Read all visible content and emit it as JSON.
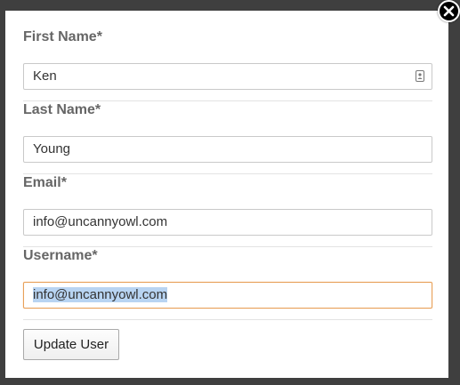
{
  "form": {
    "first_name": {
      "label": "First Name*",
      "value": "Ken"
    },
    "last_name": {
      "label": "Last Name*",
      "value": "Young"
    },
    "email": {
      "label": "Email*",
      "value": "info@uncannyowl.com"
    },
    "username": {
      "label": "Username*",
      "value": "info@uncannyowl.com"
    }
  },
  "actions": {
    "update_label": "Update User"
  },
  "icons": {
    "close": "close-icon",
    "autofill": "autofill-contact-icon"
  },
  "colors": {
    "focus_border": "#e8a15a",
    "selection": "#b8d4f2",
    "label": "#666666"
  }
}
